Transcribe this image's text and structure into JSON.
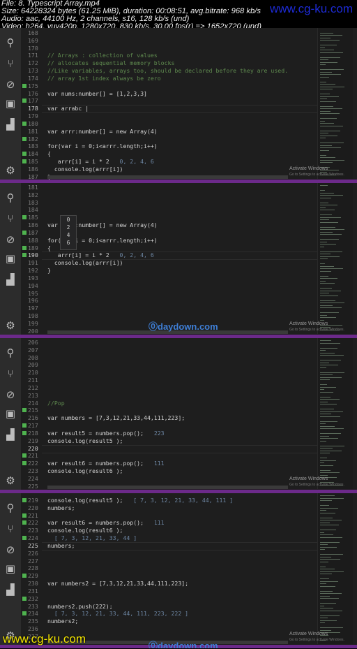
{
  "header": {
    "lines": [
      "File: 8. Typescript Array.mp4",
      "Size: 64228324 bytes (61.25 MiB), duration: 00:08:51, avg.bitrate: 968 kb/s",
      "Audio: aac, 44100 Hz, 2 channels, s16, 128 kb/s (und)",
      "Video: h264, yuv420p, 1280x720, 830 kb/s, 30.00 fps(r) => 1652x720 (und)"
    ],
    "watermark_top": "www.cg-ku.com",
    "watermark_bottom": "www.cg-ku.com"
  },
  "colors": {
    "status_bar": "#6c2a8a",
    "editor_bg": "#1e1e1e",
    "comment": "#5f8a4f",
    "modified_marker": "#4fb34f"
  },
  "activity_icons": [
    "search-icon",
    "source-control-icon",
    "debug-icon",
    "extensions-icon",
    "explorer-icon",
    "gear-icon"
  ],
  "activate_windows": {
    "title": "Activate Windows",
    "subtitle": "Go to Settings to activate Windows."
  },
  "daydown": "daydown.com",
  "frames": [
    {
      "current_line": 178,
      "lines": [
        {
          "n": 168,
          "t": ""
        },
        {
          "n": 169,
          "t": ""
        },
        {
          "n": 170,
          "t": ""
        },
        {
          "n": 171,
          "t": "// Arrays : collection of values",
          "c": true
        },
        {
          "n": 172,
          "t": "// allocates sequential memory blocks",
          "c": true
        },
        {
          "n": 173,
          "t": "//Like variables, arrays too, should be declared before they are used.",
          "c": true
        },
        {
          "n": 174,
          "t": "// array 1st index always be zero",
          "c": true
        },
        {
          "n": 175,
          "t": "",
          "m": true
        },
        {
          "n": 176,
          "t": "var nums:number[] = [1,2,3,3]"
        },
        {
          "n": 177,
          "t": "",
          "m": true
        },
        {
          "n": 178,
          "t": "var arrabc |"
        },
        {
          "n": 179,
          "t": ""
        },
        {
          "n": 180,
          "t": "",
          "m": true
        },
        {
          "n": 181,
          "t": "var arrr:number[] = new Array(4)"
        },
        {
          "n": 182,
          "t": "",
          "m": true
        },
        {
          "n": 183,
          "t": "for(var i = 0;i<arrr.length;i++)"
        },
        {
          "n": 184,
          "t": "{",
          "m": true
        },
        {
          "n": 185,
          "t": "   arrr[i] = i * 2",
          "h": "0, 2, 4, 6",
          "m": true
        },
        {
          "n": 186,
          "t": "  console.log(arrr[i])"
        },
        {
          "n": 187,
          "t": "}"
        }
      ]
    },
    {
      "current_line": 190,
      "popup": [
        "0",
        "2",
        "4",
        "6"
      ],
      "lines": [
        {
          "n": 181,
          "t": ""
        },
        {
          "n": 182,
          "t": ""
        },
        {
          "n": 183,
          "t": ""
        },
        {
          "n": 184,
          "t": ""
        },
        {
          "n": 185,
          "t": "",
          "m": true
        },
        {
          "n": 186,
          "t": "var arrr:number[] = new Array(4)"
        },
        {
          "n": 187,
          "t": "",
          "m": true
        },
        {
          "n": 188,
          "t": "for(var i = 0;i<arrr.length;i++)"
        },
        {
          "n": 189,
          "t": "{",
          "m": true
        },
        {
          "n": 190,
          "t": "   arrr[i] = i * 2",
          "h": "0, 2, 4, 6",
          "m": true
        },
        {
          "n": 191,
          "t": "  console.log(arrr[i])"
        },
        {
          "n": 192,
          "t": "}"
        },
        {
          "n": 193,
          "t": ""
        },
        {
          "n": 194,
          "t": ""
        },
        {
          "n": 195,
          "t": ""
        },
        {
          "n": 196,
          "t": ""
        },
        {
          "n": 197,
          "t": ""
        },
        {
          "n": 198,
          "t": ""
        },
        {
          "n": 199,
          "t": ""
        },
        {
          "n": 200,
          "t": ""
        }
      ]
    },
    {
      "current_line": 220,
      "lines": [
        {
          "n": 206,
          "t": ""
        },
        {
          "n": 207,
          "t": ""
        },
        {
          "n": 208,
          "t": ""
        },
        {
          "n": 209,
          "t": ""
        },
        {
          "n": 210,
          "t": ""
        },
        {
          "n": 211,
          "t": ""
        },
        {
          "n": 212,
          "t": ""
        },
        {
          "n": 213,
          "t": ""
        },
        {
          "n": 214,
          "t": "//Pop",
          "c": true
        },
        {
          "n": 215,
          "t": "",
          "m": true
        },
        {
          "n": 216,
          "t": "var numbers = [7,3,12,21,33,44,111,223];"
        },
        {
          "n": 217,
          "t": "",
          "m": true
        },
        {
          "n": 218,
          "t": "var result5 = numbers.pop();",
          "h": "223",
          "m": true
        },
        {
          "n": 219,
          "t": "console.log(result5 );"
        },
        {
          "n": 220,
          "t": ""
        },
        {
          "n": 221,
          "t": "",
          "m": true
        },
        {
          "n": 222,
          "t": "var result6 = numbers.pop();",
          "h": "111",
          "m": true
        },
        {
          "n": 223,
          "t": "console.log(result6 );"
        },
        {
          "n": 224,
          "t": ""
        },
        {
          "n": 225,
          "t": ""
        }
      ]
    },
    {
      "current_line": 225,
      "lines": [
        {
          "n": 219,
          "t": "console.log(result5 );",
          "h": "[ 7, 3, 12, 21, 33, 44, 111 ]",
          "m": true
        },
        {
          "n": 220,
          "t": "numbers;"
        },
        {
          "n": 221,
          "t": "",
          "m": true
        },
        {
          "n": 222,
          "t": "var result6 = numbers.pop();",
          "h": "111",
          "m": true
        },
        {
          "n": 223,
          "t": "console.log(result6 );"
        },
        {
          "n": 224,
          "t": "",
          "h": "  [ 7, 3, 12, 21, 33, 44 ]",
          "m": true
        },
        {
          "n": 225,
          "t": "numbers;"
        },
        {
          "n": 226,
          "t": ""
        },
        {
          "n": 227,
          "t": ""
        },
        {
          "n": 228,
          "t": ""
        },
        {
          "n": 229,
          "t": "",
          "m": true
        },
        {
          "n": 230,
          "t": "var numbers2 = [7,3,12,21,33,44,111,223];"
        },
        {
          "n": 231,
          "t": ""
        },
        {
          "n": 232,
          "t": "",
          "m": true
        },
        {
          "n": 233,
          "t": "numbers2.push(222);"
        },
        {
          "n": 234,
          "t": "",
          "h": "  [ 7, 3, 12, 21, 33, 44, 111, 223, 222 ]",
          "m": true
        },
        {
          "n": 235,
          "t": "numbers2;"
        },
        {
          "n": 236,
          "t": ""
        },
        {
          "n": 237,
          "t": ""
        }
      ]
    }
  ]
}
